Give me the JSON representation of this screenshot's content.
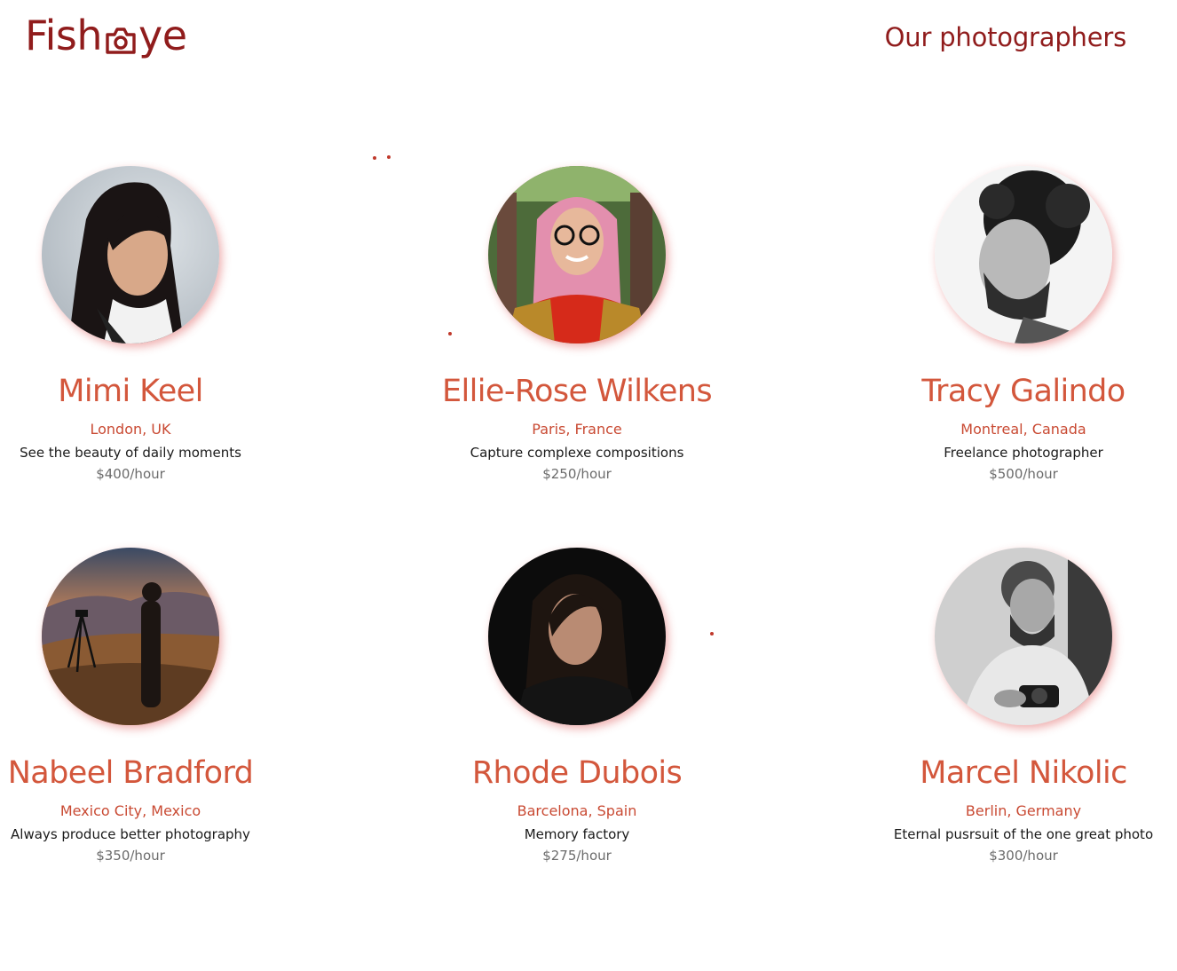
{
  "header": {
    "logo_left": "Fish",
    "logo_right": "ye",
    "logo_icon": "camera-icon",
    "title": "Our photographers"
  },
  "colors": {
    "brand": "#901c1c",
    "name": "#d3573c",
    "location": "#c94a33",
    "tagline": "#1a1a1a",
    "price": "#6b6b6b"
  },
  "photographers": [
    {
      "name": "Mimi Keel",
      "location": "London, UK",
      "tagline": "See the beauty of daily moments",
      "price": "$400/hour"
    },
    {
      "name": "Ellie-Rose Wilkens",
      "location": "Paris, France",
      "tagline": "Capture complexe compositions",
      "price": "$250/hour"
    },
    {
      "name": "Tracy Galindo",
      "location": "Montreal, Canada",
      "tagline": "Freelance photographer",
      "price": "$500/hour"
    },
    {
      "name": "Nabeel Bradford",
      "location": "Mexico City, Mexico",
      "tagline": "Always produce better photography",
      "price": "$350/hour"
    },
    {
      "name": "Rhode Dubois",
      "location": "Barcelona, Spain",
      "tagline": "Memory factory",
      "price": "$275/hour"
    },
    {
      "name": "Marcel Nikolic",
      "location": "Berlin, Germany",
      "tagline": "Eternal pusrsuit of the one great photo",
      "price": "$300/hour"
    }
  ]
}
